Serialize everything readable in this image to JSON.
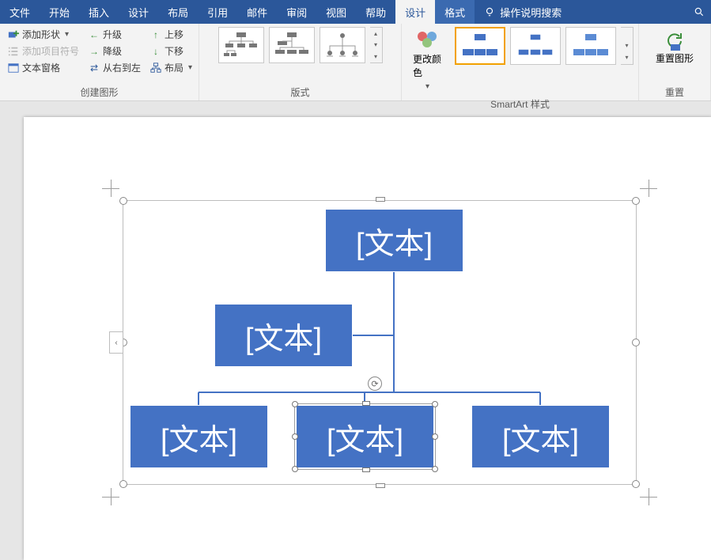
{
  "tabs": {
    "file": "文件",
    "home": "开始",
    "insert": "插入",
    "design_page": "设计",
    "layout": "布局",
    "references": "引用",
    "mailings": "邮件",
    "review": "审阅",
    "view": "视图",
    "help": "帮助",
    "design": "设计",
    "format": "格式",
    "tell_me": "操作说明搜索"
  },
  "ribbon": {
    "create_graphic": {
      "add_shape": "添加形状",
      "add_bullet": "添加项目符号",
      "text_pane": "文本窗格",
      "promote": "升级",
      "demote": "降级",
      "rtl": "从右到左",
      "move_up": "上移",
      "move_down": "下移",
      "layout_btn": "布局",
      "label": "创建图形"
    },
    "layouts_label": "版式",
    "change_colors": "更改颜色",
    "smartart_styles_label": "SmartArt 样式",
    "reset": "重置图形",
    "reset_label": "重置"
  },
  "nodes": {
    "top": "[文本]",
    "assist": "[文本]",
    "c1": "[文本]",
    "c2": "[文本]",
    "c3": "[文本]"
  },
  "expand_tab_glyph": "‹"
}
